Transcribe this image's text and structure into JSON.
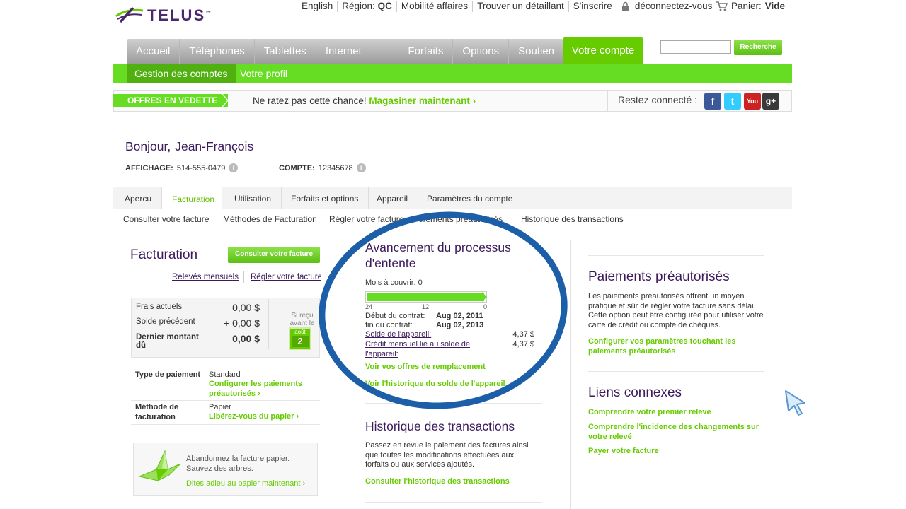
{
  "logo": {
    "text": "TELUS",
    "mark": "™"
  },
  "topnav": {
    "english": "English",
    "region_label": "Région:",
    "region_value": "QC",
    "business": "Mobilité affaires",
    "retailer": "Trouver un détaillant",
    "signup": "S'inscrire",
    "logout": "déconnectez-vous",
    "cart_label": "Panier:",
    "cart_value": "Vide"
  },
  "mainnav": {
    "tabs": [
      "Accueil",
      "Téléphones",
      "Tablettes",
      "Internet mobile",
      "Forfaits",
      "Options",
      "Soutien"
    ],
    "active": "Votre compte"
  },
  "search": {
    "button": "Recherche",
    "placeholder": ""
  },
  "subnav": {
    "active": "Gestion des comptes",
    "other": "Votre profil"
  },
  "promo": {
    "tag": "OFFRES EN VEDETTE",
    "text": "Ne ratez pas cette chance!",
    "link": "Magasiner maintenant",
    "link_arrow": "›",
    "social_label": "Restez connecté :",
    "social": [
      {
        "name": "facebook",
        "glyph": "f",
        "color": "#3b5998"
      },
      {
        "name": "twitter",
        "glyph": "t",
        "color": "#33ccff"
      },
      {
        "name": "youtube",
        "glyph": "You",
        "color": "#cc2222"
      },
      {
        "name": "google-plus",
        "glyph": "g+",
        "color": "#3a3a3a"
      }
    ]
  },
  "greeting": {
    "hello": "Bonjour,",
    "name": "Jean-François"
  },
  "account": {
    "display_label": "AFFICHAGE:",
    "display_value": "514-555-0479",
    "account_label": "COMPTE:",
    "account_value": "12345678"
  },
  "account_tabs": [
    "Apercu",
    "Facturation",
    "Utilisation",
    "Forfaits et options",
    "Appareil",
    "Paramètres du compte"
  ],
  "account_sub": [
    "Consulter votre facture",
    "Méthodes de Facturation",
    "Régler votre facture",
    "Paiements préautorisés",
    "Historique des transactions"
  ],
  "facturation": {
    "title": "Facturation",
    "view_button": "Consulter votre facture",
    "monthly_link": "Relevés mensuels",
    "pay_link": "Régler votre facture",
    "current_label": "Frais actuels",
    "current_value": "0,00 $",
    "previous_label": "Solde précédent",
    "previous_value": "+ 0,00 $",
    "last_label": "Dernier montant dû",
    "last_value": "0,00 $",
    "due_text": "Si reçu avant le",
    "due_month": "août",
    "due_day": "2",
    "payment_type_label": "Type de paiement",
    "payment_type_value": "Standard",
    "payment_type_link": "Configurer les paiements préautorisés",
    "billing_method_label": "Méthode de facturation",
    "billing_method_value": "Papier",
    "billing_method_link": "Libérez-vous du papier",
    "crane_text": "Abandonnez la facture papier. Sauvez des arbres.",
    "crane_link": "Dites adieu au papier maintenant",
    "arrow": "›"
  },
  "progress": {
    "title": "Avancement du processus d'entente",
    "months_label": "Mois à couvrir:",
    "months_value": "0",
    "fill_fraction": 1.0,
    "ticks": [
      "24",
      "12",
      "0"
    ],
    "start_label": "Début du contrat:",
    "start_value": "Aug 02, 2011",
    "end_label": "fin du contrat:",
    "end_value": "Aug 02, 2013",
    "device_balance_label": "Solde de l'appareil:",
    "device_balance_value": "4,37 $",
    "monthly_credit_label": "Crédit mensuel lié au solde de l'appareil:",
    "monthly_credit_value": "4,37 $",
    "offers_link": "Voir vos offres de remplacement",
    "history_link": "Voir l'historique du solde de l'appareil"
  },
  "transactions": {
    "title": "Historique des transactions",
    "text": "Passez en revue le paiement des factures ainsi que toutes les modifications effectuées aux forfaits ou aux services ajoutés.",
    "link": "Consulter l'historique des transactions"
  },
  "preauth": {
    "title": "Paiements préautorisés",
    "text": "Les paiements préautorisés offrent un moyen pratique et sûr de régler votre facture sans délai. Cette option peut être configurée pour utiliser votre carte de crédit ou compte de chèques.",
    "link": "Configurer vos paramètres touchant les paiements préautorisés"
  },
  "related": {
    "title": "Liens connexes",
    "links": [
      "Comprendre votre premier relevé",
      "Comprendre l'incidence des changements sur votre relevé",
      "Payer votre facture"
    ]
  },
  "colors": {
    "brand_purple": "#4b286d",
    "brand_green": "#66cc00",
    "annotation_blue": "#1c5fa8"
  }
}
